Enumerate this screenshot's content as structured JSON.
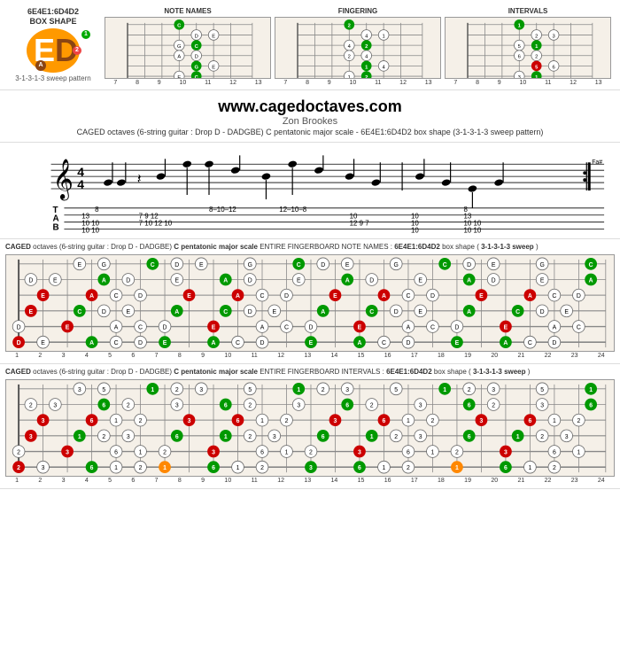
{
  "header": {
    "title": "6E4E1:6D4D2",
    "subtitle": "BOX SHAPE",
    "logo_e": "E",
    "logo_d": "D",
    "logo_dot1": "1",
    "logo_dot2": "2",
    "logo_dot3": "A",
    "sweep_pattern": "3-1-3-1-3 sweep pattern"
  },
  "diagrams": {
    "note_names": {
      "label": "NOTE NAMES",
      "frets": [
        "7",
        "8",
        "9",
        "10",
        "11",
        "12",
        "13"
      ]
    },
    "fingering": {
      "label": "FINGERING",
      "frets": [
        "7",
        "8",
        "9",
        "10",
        "11",
        "12",
        "13"
      ]
    },
    "intervals": {
      "label": "INTERVALS",
      "frets": [
        "7",
        "8",
        "9",
        "10",
        "11",
        "12",
        "13"
      ]
    }
  },
  "website": {
    "url": "www.cagedoctaves.com",
    "author": "Zon Brookes",
    "description": "CAGED octaves (6-string guitar : Drop D - DADGBE) C pentatonic major scale - 6E4E1:6D4D2 box shape (3-1-3-1-3 sweep pattern)"
  },
  "caged_label": "CAGED",
  "full_board_note_names": {
    "title_prefix": "CAGED octaves (6-string guitar : Drop D - DADGBE)",
    "scale": "C pentatonic major scale",
    "board_type": "ENTIRE FINGERBOARD NOTE NAMES",
    "shape": "6E4E1:6D4D2",
    "box_shape": "box shape",
    "sweep": "3-1-3-1-3 sweep",
    "frets": [
      "1",
      "2",
      "3",
      "4",
      "5",
      "6",
      "7",
      "8",
      "9",
      "10",
      "11",
      "12",
      "13",
      "14",
      "15",
      "16",
      "17",
      "18",
      "19",
      "20",
      "21",
      "22",
      "23",
      "24"
    ]
  },
  "full_board_intervals": {
    "title_prefix": "CAGED octaves (6-string guitar : Drop D - DADGBE)",
    "scale": "C pentatonic major scale",
    "board_type": "ENTIRE FINGERBOARD INTERVALS",
    "shape": "6E4E1:6D4D2",
    "box_shape": "box shape",
    "sweep": "3-1-3-1-3 sweep",
    "frets": [
      "1",
      "2",
      "3",
      "4",
      "5",
      "6",
      "7",
      "8",
      "9",
      "10",
      "11",
      "12",
      "13",
      "14",
      "15",
      "16",
      "17",
      "18",
      "19",
      "20",
      "21",
      "22",
      "23",
      "24"
    ]
  },
  "colors": {
    "green": "#009900",
    "red": "#cc0000",
    "orange": "#ff8800",
    "black": "#000000",
    "white": "#ffffff",
    "bg_fretboard": "#f5f0e8",
    "accent_orange": "#ff9900"
  }
}
